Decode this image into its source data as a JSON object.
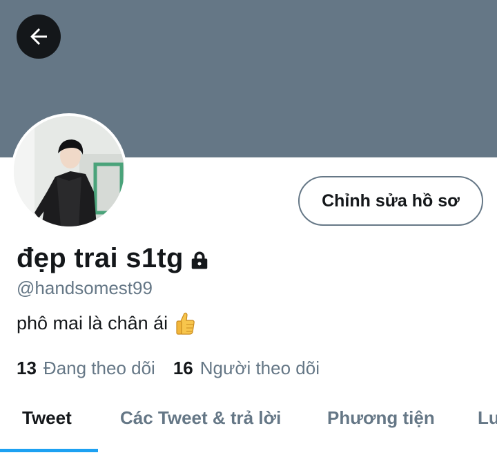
{
  "profile": {
    "display_name": "đẹp trai s1tg",
    "handle": "@handsomest99",
    "bio": "phô mai là chân ái",
    "locked": true
  },
  "actions": {
    "edit_profile_label": "Chỉnh sửa hồ sơ"
  },
  "stats": {
    "following_count": "13",
    "following_label": "Đang theo dõi",
    "followers_count": "16",
    "followers_label": "Người theo dõi"
  },
  "tabs": [
    {
      "label": "Tweet",
      "active": true
    },
    {
      "label": "Các Tweet & trả lời",
      "active": false
    },
    {
      "label": "Phương tiện",
      "active": false
    },
    {
      "label": "Lư",
      "active": false
    }
  ],
  "icons": {
    "back": "arrow-left-icon",
    "lock": "lock-icon",
    "bio_emoji": "thumbs-up-icon"
  },
  "colors": {
    "banner": "#657786",
    "accent": "#1da1f2",
    "primary_text": "#14171a",
    "secondary_text": "#657786"
  }
}
